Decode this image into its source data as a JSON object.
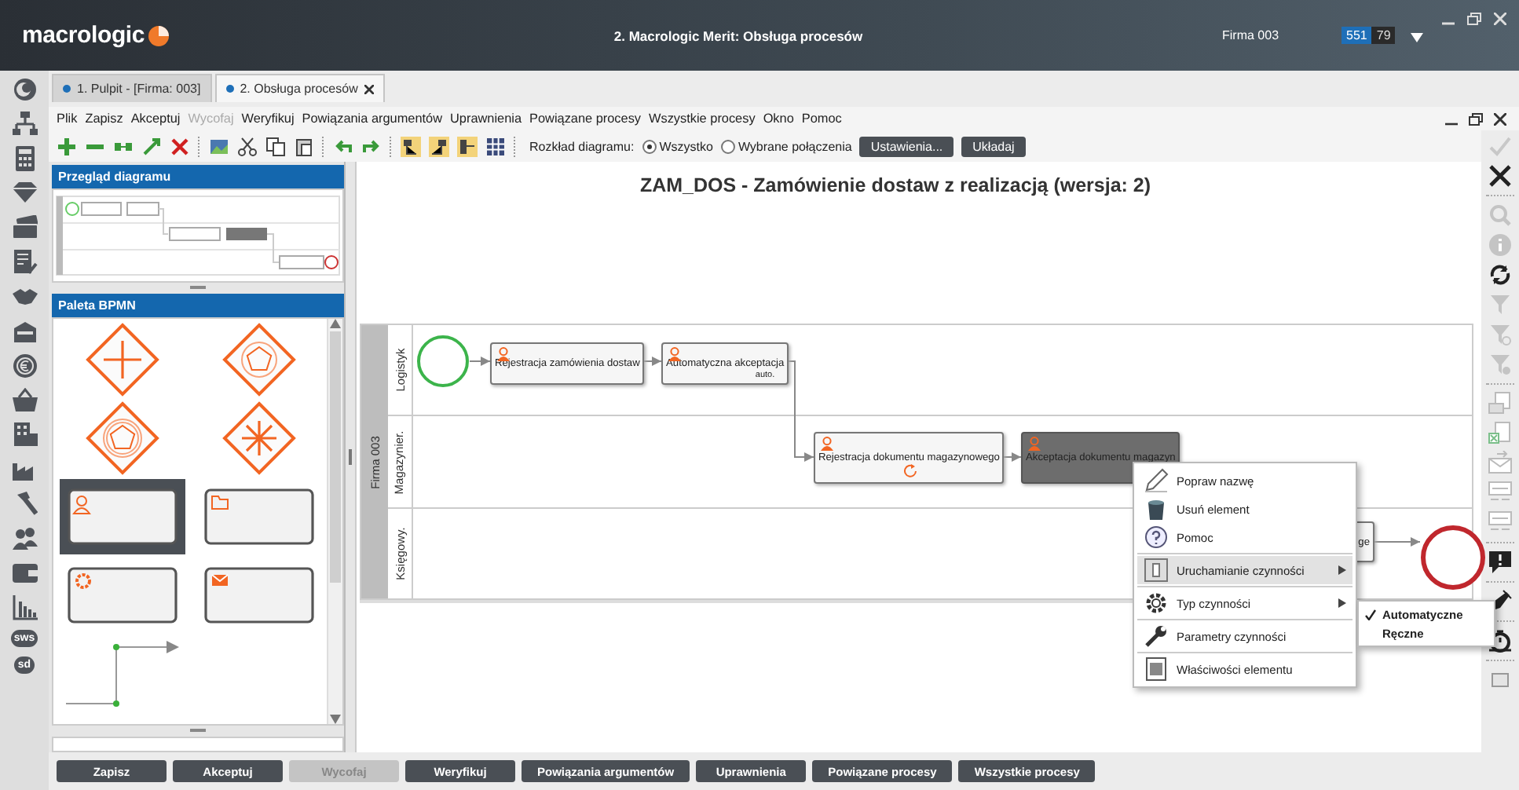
{
  "header": {
    "logo": "macrologic",
    "title": "2. Macrologic Merit: Obsługa procesów",
    "company": "Firma 003",
    "counter_a": "551",
    "counter_b": "79"
  },
  "sidebar": {
    "text_icons": [
      "sws",
      "sd"
    ]
  },
  "tabs": [
    {
      "label": "1. Pulpit - [Firma: 003]",
      "selected": false,
      "closable": false
    },
    {
      "label": "2. Obsługa procesów",
      "selected": true,
      "closable": true
    }
  ],
  "menu": [
    {
      "label": "Plik",
      "disabled": false
    },
    {
      "label": "Zapisz",
      "disabled": false
    },
    {
      "label": "Akceptuj",
      "disabled": false
    },
    {
      "label": "Wycofaj",
      "disabled": true
    },
    {
      "label": "Weryfikuj",
      "disabled": false
    },
    {
      "label": "Powiązania argumentów",
      "disabled": false
    },
    {
      "label": "Uprawnienia",
      "disabled": false
    },
    {
      "label": "Powiązane procesy",
      "disabled": false
    },
    {
      "label": "Wszystkie procesy",
      "disabled": false
    },
    {
      "label": "Okno",
      "disabled": false
    },
    {
      "label": "Pomoc",
      "disabled": false
    }
  ],
  "toolbar": {
    "layout_label": "Rozkład diagramu:",
    "options": [
      {
        "label": "Wszystko",
        "selected": true
      },
      {
        "label": "Wybrane połączenia",
        "selected": false
      }
    ],
    "buttons": [
      "Ustawienia...",
      "Układaj"
    ]
  },
  "overview": {
    "title": "Przegląd diagramu"
  },
  "palette": {
    "title": "Paleta BPMN",
    "items": [
      {
        "kind": "gateway-parallel",
        "selected": false
      },
      {
        "kind": "gateway-event",
        "selected": false
      },
      {
        "kind": "gateway-event-double",
        "selected": false
      },
      {
        "kind": "gateway-complex",
        "selected": false
      },
      {
        "kind": "task-user",
        "selected": true
      },
      {
        "kind": "task-folder",
        "selected": false
      },
      {
        "kind": "task-service",
        "selected": false
      },
      {
        "kind": "task-message",
        "selected": false
      },
      {
        "kind": "connector",
        "selected": false
      }
    ]
  },
  "diagram": {
    "title": "ZAM_DOS - Zamówienie dostaw z realizacją (wersja: 2)",
    "pool": "Firma 003",
    "lanes": [
      "Logistyk",
      "Magazynier.",
      "Księgowy."
    ],
    "tasks": [
      {
        "label": "Rejestracja zamówienia dostaw",
        "selected": false
      },
      {
        "label": "Automatyczna akceptacja",
        "note": "auto.",
        "selected": false
      },
      {
        "label": "Rejestracja dokumentu magazynowego",
        "loop": true,
        "selected": false
      },
      {
        "label": "Akceptacja dokumentu magazyn",
        "selected": true
      },
      {
        "label": "ge",
        "selected": false
      }
    ]
  },
  "context_menu": [
    {
      "label": "Popraw nazwę",
      "kind": "item",
      "selected": false
    },
    {
      "label": "Usuń element",
      "kind": "item",
      "selected": false
    },
    {
      "label": "Pomoc",
      "kind": "item",
      "selected": false
    },
    {
      "label": "Uruchamianie czynności",
      "kind": "submenu",
      "selected": true
    },
    {
      "label": "Typ czynności",
      "kind": "submenu",
      "selected": false
    },
    {
      "label": "Parametry czynności",
      "kind": "item",
      "selected": false
    },
    {
      "label": "Właściwości elementu",
      "kind": "item",
      "selected": false
    }
  ],
  "submenu": [
    {
      "label": "Automatyczne",
      "checked": true
    },
    {
      "label": "Ręczne",
      "checked": false
    }
  ],
  "bottom_buttons": [
    {
      "label": "Zapisz",
      "disabled": false
    },
    {
      "label": "Akceptuj",
      "disabled": false
    },
    {
      "label": "Wycofaj",
      "disabled": true
    },
    {
      "label": "Weryfikuj",
      "disabled": false
    },
    {
      "label": "Powiązania argumentów",
      "disabled": false
    },
    {
      "label": "Uprawnienia",
      "disabled": false
    },
    {
      "label": "Powiązane procesy",
      "disabled": false
    },
    {
      "label": "Wszystkie procesy",
      "disabled": false
    }
  ]
}
